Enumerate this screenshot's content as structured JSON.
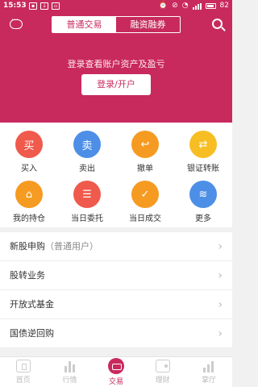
{
  "status": {
    "time": "15:53",
    "battery": "82"
  },
  "header": {
    "tabs": [
      {
        "label": "普通交易",
        "active": true
      },
      {
        "label": "融资融券",
        "active": false
      }
    ],
    "login_hint": "登录查看账户资产及盈亏",
    "login_button": "登录/开户"
  },
  "actions": [
    {
      "label": "买入",
      "glyph": "买",
      "color": "red"
    },
    {
      "label": "卖出",
      "glyph": "卖",
      "color": "blue"
    },
    {
      "label": "撤单",
      "glyph": "↩",
      "color": "orange"
    },
    {
      "label": "银证转账",
      "glyph": "⇄",
      "color": "yellow"
    },
    {
      "label": "我的持仓",
      "glyph": "⌂",
      "color": "orange"
    },
    {
      "label": "当日委托",
      "glyph": "☰",
      "color": "red"
    },
    {
      "label": "当日成交",
      "glyph": "✓",
      "color": "orange"
    },
    {
      "label": "更多",
      "glyph": "≋",
      "color": "blue"
    }
  ],
  "menu": {
    "items": [
      {
        "label": "新股申购",
        "sub": "（普通用户）"
      },
      {
        "label": "股转业务",
        "sub": ""
      },
      {
        "label": "开放式基金",
        "sub": ""
      },
      {
        "label": "国债逆回购",
        "sub": ""
      }
    ]
  },
  "bottom_nav": [
    {
      "label": "首页",
      "icon": "home-icon",
      "active": false
    },
    {
      "label": "行情",
      "icon": "market-icon",
      "active": false
    },
    {
      "label": "交易",
      "icon": "trade-icon",
      "active": true
    },
    {
      "label": "理财",
      "icon": "finance-icon",
      "active": false
    },
    {
      "label": "掌厅",
      "icon": "hall-icon",
      "active": false
    }
  ],
  "colors": {
    "brand": "#c82a5e"
  }
}
